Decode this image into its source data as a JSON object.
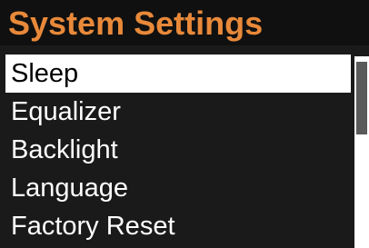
{
  "header": {
    "title": "System Settings"
  },
  "menu": {
    "items": [
      {
        "label": "Sleep",
        "selected": true
      },
      {
        "label": "Equalizer",
        "selected": false
      },
      {
        "label": "Backlight",
        "selected": false
      },
      {
        "label": "Language",
        "selected": false
      },
      {
        "label": "Factory Reset",
        "selected": false
      }
    ]
  },
  "scrollbar": {
    "visible_fraction": 0.38,
    "position_fraction": 0.0
  },
  "colors": {
    "title": "#e8893a",
    "background": "#1a1a1a",
    "selected_bg": "#ffffff",
    "selected_text": "#000000",
    "item_text": "#ffffff"
  }
}
